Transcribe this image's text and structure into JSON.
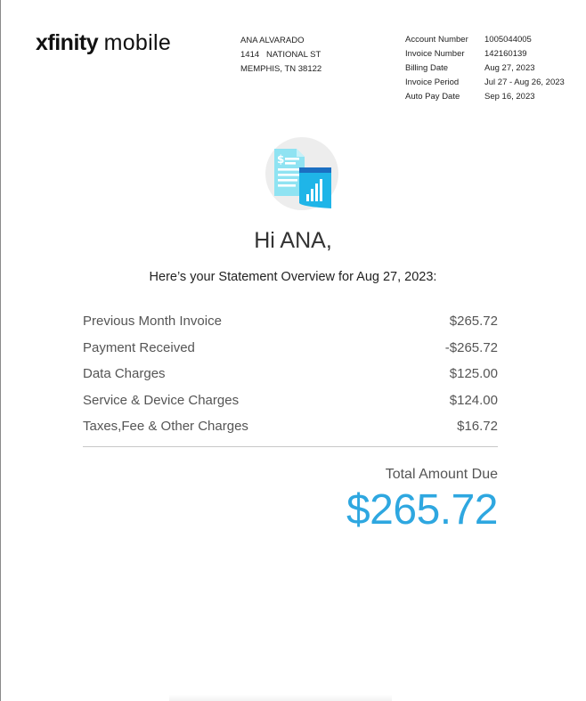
{
  "brand": {
    "name_part1": "xfinity",
    "name_part2": "mobile"
  },
  "customer": {
    "name": "ANA ALVARADO",
    "street": "1414   NATIONAL ST",
    "city": "MEMPHIS, TN 38122"
  },
  "account_info": [
    {
      "label": "Account Number",
      "value": "1005044005"
    },
    {
      "label": "Invoice Number",
      "value": "142160139"
    },
    {
      "label": "Billing Date",
      "value": "Aug 27, 2023"
    },
    {
      "label": "Invoice Period",
      "value": "Jul 27 - Aug 26, 2023"
    },
    {
      "label": "Auto Pay Date",
      "value": "Sep 16, 2023"
    }
  ],
  "greeting": "Hi ANA,",
  "overview_title": "Here’s your Statement Overview for Aug 27, 2023:",
  "charges": [
    {
      "label": "Previous Month Invoice",
      "amount": "$265.72"
    },
    {
      "label": "Payment Received",
      "amount": "-$265.72"
    },
    {
      "label": "Data Charges",
      "amount": "$125.00"
    },
    {
      "label": "Service & Device Charges",
      "amount": "$124.00"
    },
    {
      "label": "Taxes,Fee & Other Charges",
      "amount": "$16.72"
    }
  ],
  "total": {
    "label": "Total Amount Due",
    "amount": "$265.72"
  },
  "icons": {
    "hero": "statement-document-chart-icon"
  },
  "colors": {
    "accent": "#2ea7e0",
    "icon_light": "#8fe3f2",
    "icon_dark": "#1b6fc2"
  }
}
